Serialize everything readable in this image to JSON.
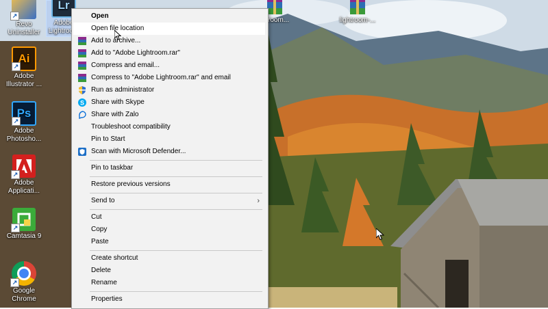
{
  "desktop": {
    "icons": [
      {
        "label": "Revo\nUninstaller",
        "icon": "revo-uninstaller-icon",
        "color": "#3a6fc4"
      },
      {
        "label": "Adobe\nLightroom",
        "icon": "lightroom-icon",
        "color": "#1f2b3a",
        "glyph": "Lr",
        "selected": true
      },
      {
        "label": "Adobe\nIllustrator ...",
        "icon": "illustrator-icon",
        "color": "#2d1a05",
        "glyph": "Ai",
        "glyph_color": "#ff9a00"
      },
      {
        "label": "Adobe\nPhotosho...",
        "icon": "photoshop-icon",
        "color": "#061c36",
        "glyph": "Ps",
        "glyph_color": "#31a8ff"
      },
      {
        "label": "Adobe\nApplicati...",
        "icon": "adobe-application-icon",
        "color": "#d3201e"
      },
      {
        "label": "Camtasia 9",
        "icon": "camtasia-icon",
        "color": "#3bab3a"
      },
      {
        "label": "Google\nChrome",
        "icon": "chrome-icon",
        "color": "#db4437"
      }
    ],
    "top_icons": [
      {
        "label": "...troom...",
        "icon": "winrar-archive-icon"
      },
      {
        "label": "lightroom-...",
        "icon": "winrar-archive-icon"
      }
    ]
  },
  "context_menu": {
    "items": [
      {
        "label": "Open",
        "bold": true,
        "icon": ""
      },
      {
        "label": "Open file location",
        "icon": "",
        "hover": true
      },
      {
        "label": "Add to archive...",
        "icon": "winrar-icon"
      },
      {
        "label": "Add to \"Adobe Lightroom.rar\"",
        "icon": "winrar-icon"
      },
      {
        "label": "Compress and email...",
        "icon": "winrar-icon"
      },
      {
        "label": "Compress to \"Adobe Lightroom.rar\" and email",
        "icon": "winrar-icon"
      },
      {
        "label": "Run as administrator",
        "icon": "uac-shield-icon"
      },
      {
        "label": "Share with Skype",
        "icon": "skype-icon"
      },
      {
        "label": "Share with Zalo",
        "icon": "zalo-icon"
      },
      {
        "label": "Troubleshoot compatibility",
        "icon": ""
      },
      {
        "label": "Pin to Start",
        "icon": ""
      },
      {
        "label": "Scan with Microsoft Defender...",
        "icon": "defender-icon"
      },
      {
        "label": "Pin to taskbar",
        "icon": ""
      },
      {
        "label": "Restore previous versions",
        "icon": ""
      },
      {
        "label": "Send to",
        "icon": "",
        "submenu": true
      },
      {
        "label": "Cut",
        "icon": ""
      },
      {
        "label": "Copy",
        "icon": ""
      },
      {
        "label": "Paste",
        "icon": ""
      },
      {
        "label": "Create shortcut",
        "icon": ""
      },
      {
        "label": "Delete",
        "icon": ""
      },
      {
        "label": "Rename",
        "icon": ""
      },
      {
        "label": "Properties",
        "icon": ""
      }
    ],
    "submenu_arrow": "›"
  },
  "colors": {
    "menu_bg": "#f2f2f2",
    "menu_hover": "#ffffff",
    "menu_border": "#a0a0a0",
    "separator": "#c8c8c8"
  }
}
